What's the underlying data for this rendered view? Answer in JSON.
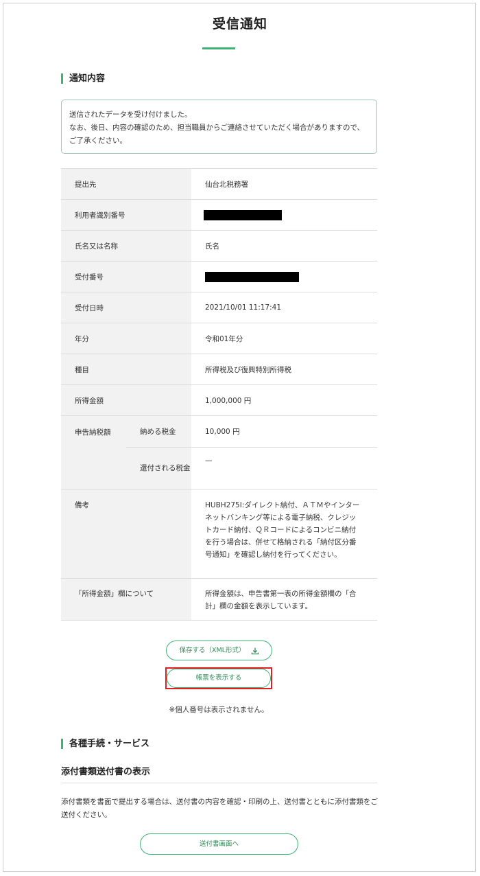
{
  "page": {
    "title": "受信通知"
  },
  "notice_section": {
    "heading": "通知内容",
    "message_line1": "送信されたデータを受け付けました。",
    "message_line2": "なお、後日、内容の確認のため、担当職員からご連絡させていただく場合がありますので、ご了承ください。"
  },
  "details": {
    "submit_to_label": "提出先",
    "submit_to_value": "仙台北税務署",
    "user_id_label": "利用者識別番号",
    "name_label": "氏名又は名称",
    "name_value": "氏名",
    "receipt_no_label": "受付番号",
    "receipt_datetime_label": "受付日時",
    "receipt_datetime_value": "2021/10/01 11:17:41",
    "year_label": "年分",
    "year_value": "令和01年分",
    "item_label": "種目",
    "item_value": "所得税及び復興特別所得税",
    "income_label": "所得金額",
    "income_value": "1,000,000 円",
    "tax_label": "申告納税額",
    "tax_pay_label": "納める税金",
    "tax_pay_value": "10,000 円",
    "tax_refund_label": "還付される税金",
    "tax_refund_value": "—",
    "remarks_label": "備考",
    "remarks_value": "HUBH275I:ダイレクト納付、ＡＴＭやインターネットバンキング等による電子納税、クレジットカード納付、ＱＲコードによるコンビニ納付を行う場合は、併せて格納される「納付区分番号通知」を確認し納付を行ってください。",
    "income_note_label": "「所得金額」欄について",
    "income_note_value": "所得金額は、申告書第一表の所得金額欄の「合計」欄の金額を表示しています。"
  },
  "actions": {
    "save_xml_label": "保存する（XML形式）",
    "show_form_label": "帳票を表示する",
    "note": "※個人番号は表示されません。"
  },
  "services_section": {
    "heading": "各種手続・サービス",
    "subheading": "添付書類送付書の表示",
    "description": "添付書類を書面で提出する場合は、送付書の内容を確認・印刷の上、送付書とともに添付書類をご送付ください。",
    "button_label": "送付書画面へ"
  },
  "colors": {
    "accent": "#3cb371",
    "highlight": "#e02020",
    "label_bg": "#f2f2f2"
  },
  "icons": {
    "download": "download-icon"
  }
}
